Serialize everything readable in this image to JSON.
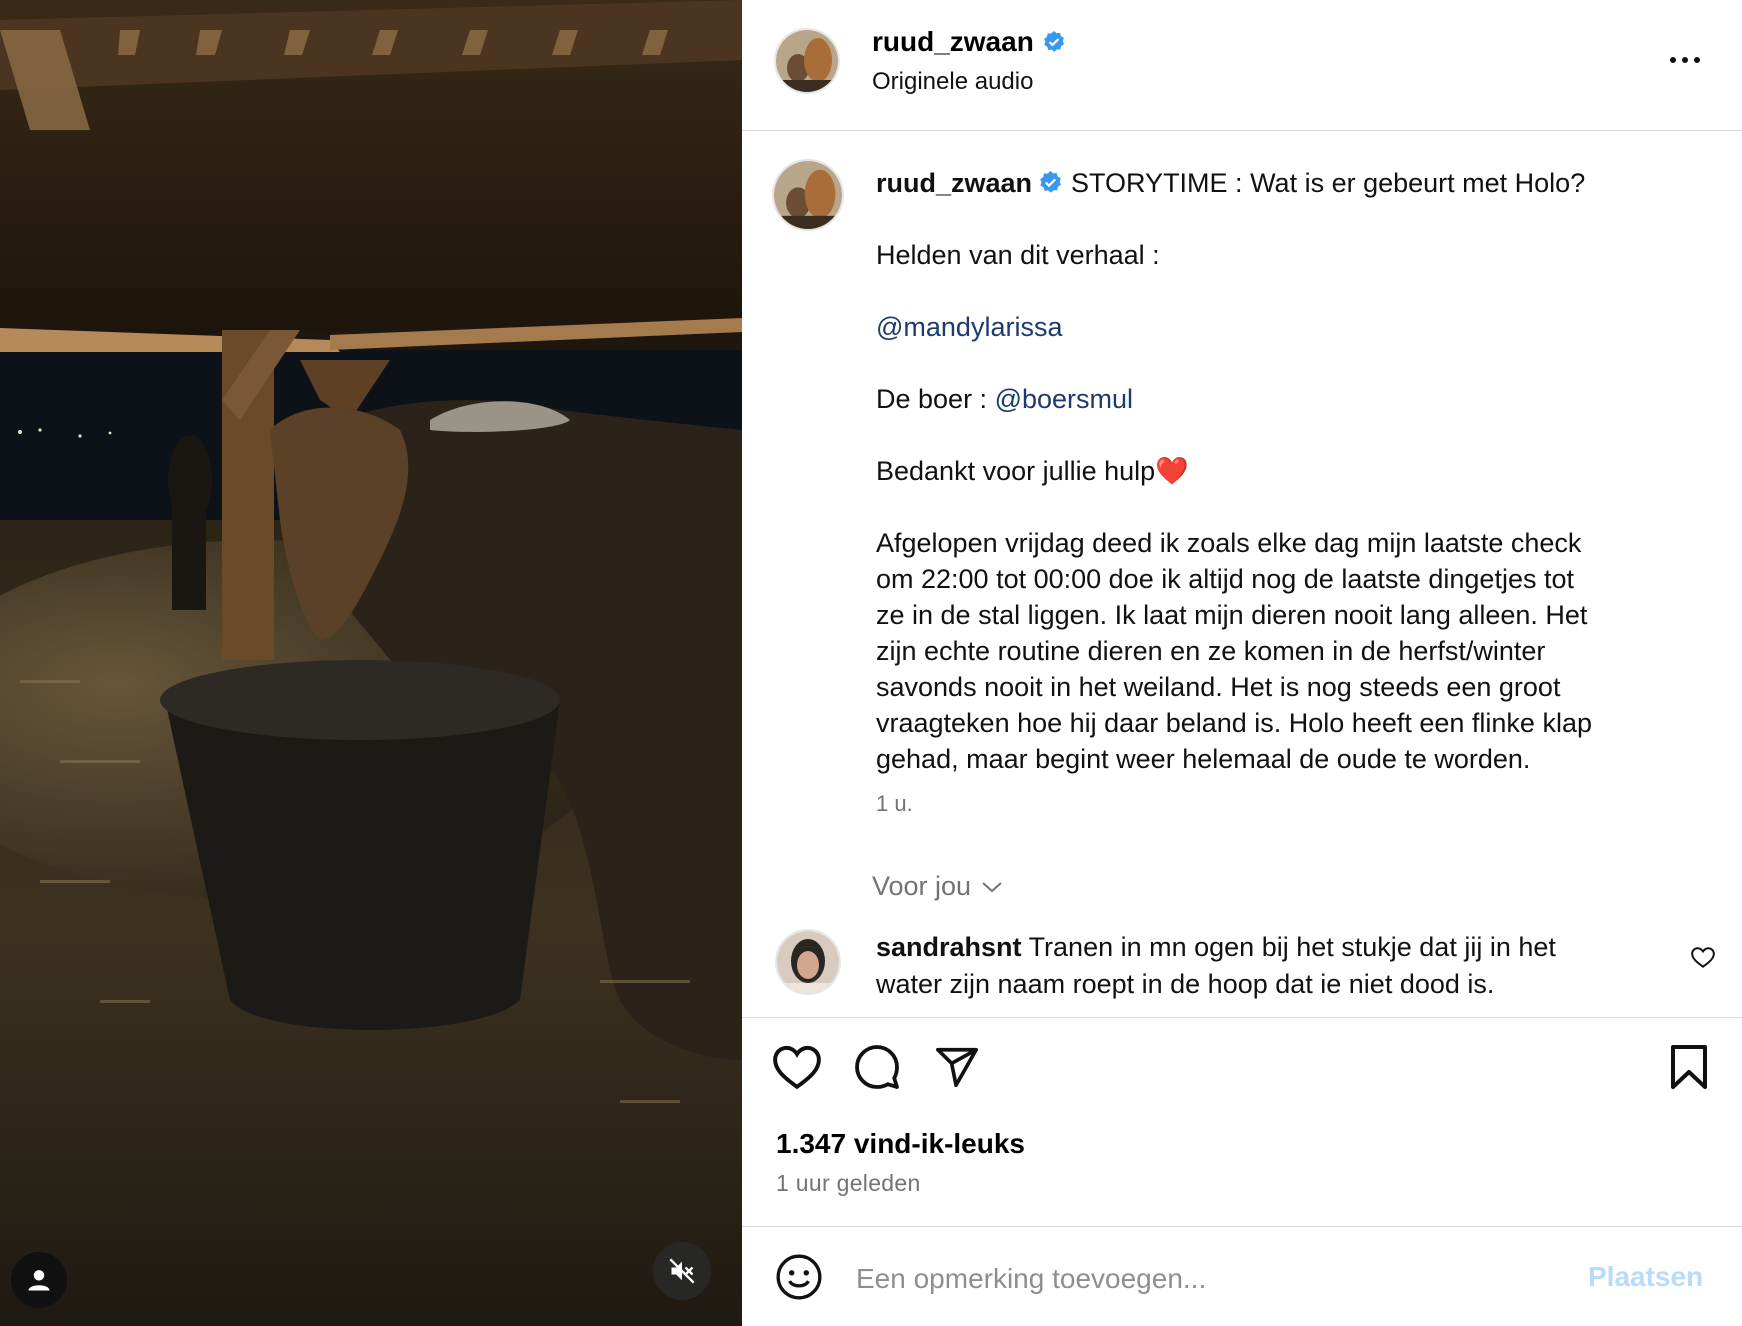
{
  "post": {
    "author": "ruud_zwaan",
    "audio_label": "Originele audio",
    "verified_color": "#3897f0"
  },
  "caption": {
    "username": "ruud_zwaan",
    "title": "STORYTIME : Wat is er gebeurt met Holo?",
    "heroes_label": "Helden van dit verhaal :",
    "mention_1": "@mandylarissa",
    "farmer_label": "De boer : ",
    "mention_2": "@boersmul",
    "thanks": "Bedankt voor jullie hulp❤️",
    "body": "Afgelopen vrijdag deed ik zoals elke dag mijn laatste check\nom 22:00 tot 00:00 doe ik altijd nog de laatste dingetjes tot\nze in de stal liggen. Ik laat mijn dieren nooit lang alleen. Het\nzijn echte routine dieren en ze komen in de herfst/winter\nsavonds nooit in het weiland. Het is nog steeds een groot\nvraagteken hoe hij daar beland is. Holo heeft een flinke klap\ngehad, maar begint weer helemaal de oude te worden.",
    "time": "1 u."
  },
  "comments_filter": {
    "label": "Voor jou"
  },
  "comments": [
    {
      "username": "sandrahsnt",
      "text": "Tranen in mn ogen bij het stukje dat jij in het\nwater zijn naam roept in de hoop dat ie niet dood is."
    }
  ],
  "stats": {
    "likes": "1.347 vind-ik-leuks",
    "time": "1 uur geleden"
  },
  "composer": {
    "placeholder": "Een opmerking toevoegen...",
    "post_label": "Plaatsen",
    "post_color": "#b6dbfb"
  },
  "icons": {
    "media": [
      "user-tag-icon",
      "muted-speaker-icon"
    ],
    "header": [
      "more-options-icon"
    ],
    "actions": [
      "heart-icon",
      "comment-icon",
      "share-icon",
      "bookmark-icon"
    ],
    "composer": [
      "emoji-icon"
    ]
  }
}
